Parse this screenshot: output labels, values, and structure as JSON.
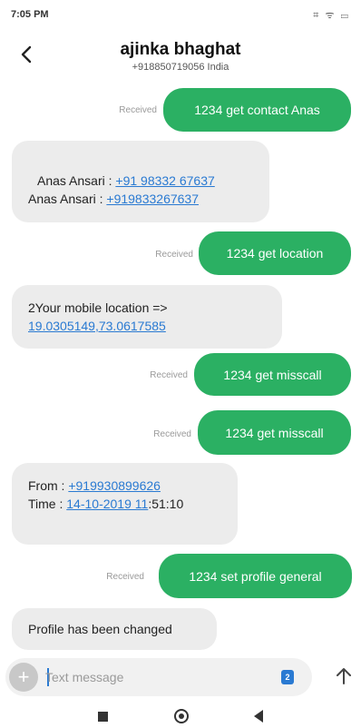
{
  "status": {
    "time": "7:05 PM",
    "icons": "⌗ ᯤ ▭"
  },
  "header": {
    "contact_name": "ajinka bhaghat",
    "contact_number": "+918850719056 India"
  },
  "received_label": "Received",
  "messages": [
    {
      "dir": "out",
      "text": "1234 get contact Anas"
    },
    {
      "dir": "in",
      "lines": [
        {
          "prefix": "Anas Ansari : ",
          "link": "+91 98332 67637"
        },
        {
          "prefix": "Anas Ansari : ",
          "link": "+919833267637"
        }
      ]
    },
    {
      "dir": "out",
      "text": "1234 get location"
    },
    {
      "dir": "in",
      "line1": "2Your mobile location =>",
      "link": "19.0305149,73.0617585"
    },
    {
      "dir": "out",
      "text": "1234 get misscall"
    },
    {
      "dir": "out",
      "text": "1234 get misscall"
    },
    {
      "dir": "in",
      "from_label": "From : ",
      "from_link": "+919930899626",
      "time_label": "Time : ",
      "time_link": "14-10-2019 11",
      "time_rest": ":51:10"
    },
    {
      "dir": "out",
      "text": "1234 set profile general"
    },
    {
      "dir": "in",
      "text": "Profile has been changed"
    }
  ],
  "composer": {
    "placeholder": "Text message",
    "sim_label": "2"
  },
  "colors": {
    "outgoing_bubble": "#2bb063",
    "incoming_bubble": "#ececec",
    "link": "#2a7ad2"
  }
}
